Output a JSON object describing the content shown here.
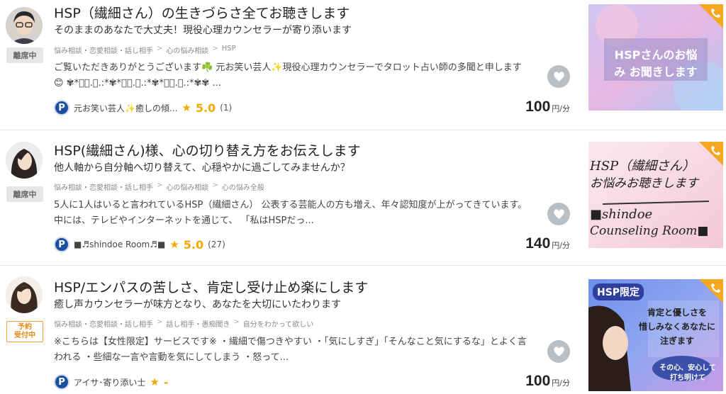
{
  "listings": [
    {
      "title": "HSP（繊細さん）の生きづらさ全てお聴きします",
      "subtitle": "そのままのあなたで大丈夫！現役心理カウンセラーが寄り添います",
      "status": "離席中",
      "breadcrumb": [
        "悩み相談・恋愛相談・話し相手",
        "心の悩み相談",
        "HSP"
      ],
      "description": "ご覧いただきありがとうございます☘️ 元お笑い芸人✨現役心理カウンセラーでタロット占い師の多聞と申します😊 ✾*ﾟ･.｡.:*✾*ﾟ･.｡.:*✾*ﾟ･.｡.:*✾✾ ...",
      "provider": "元お笑い芸人✨癒しの傾...",
      "rating": "5.0",
      "review_count": "(1)",
      "price": "100",
      "price_unit": "円/分",
      "thumb_text": [
        "HSPさんのお悩",
        "み お聞きします"
      ]
    },
    {
      "title": "HSP(繊細さん)様、心の切り替え方をお伝えします",
      "subtitle": "他人軸から自分軸へ切り替えて、心穏やかに過ごしてみませんか？",
      "status": "離席中",
      "breadcrumb": [
        "悩み相談・恋愛相談・話し相手",
        "心の悩み相談",
        "心の悩み全般"
      ],
      "description": "5人に1人はいると言われているHSP（繊細さん） 公表する芸能人の方も増え、年々認知度が上がってきています。 中には、テレビやインターネットを通じて、 「私はHSPだっ...",
      "provider": "■♬shindoe Room♬■",
      "rating": "5.0",
      "review_count": "(27)",
      "price": "140",
      "price_unit": "円/分",
      "thumb_text": [
        "HSP（繊細さん）",
        "お悩みお聴きします",
        "■shindoe",
        "Counseling Room■"
      ]
    },
    {
      "title": "HSP/エンパスの苦しさ、肯定し受け止め楽にします",
      "subtitle": "癒し声カウンセラーが味方となり、あなたを大切にいたわります",
      "status": "予約\n受付中",
      "breadcrumb": [
        "悩み相談・恋愛相談・話し相手",
        "話し相手・愚痴聞き",
        "自分をわかって欲しい"
      ],
      "description": "※こちらは【女性限定】サービスです※ ・繊細で傷つきやすい ・「気にしすぎ」「そんなこと気にするな」とよく言われる ・些細な一言や言動を気にしてしまう ・怒って...",
      "provider": "アイサ･寄り添い士",
      "rating": "-",
      "review_count": "",
      "price": "100",
      "price_unit": "円/分",
      "thumb_text": [
        "HSP限定",
        "肯定と優しさを",
        "惜しみなくあなたに",
        "注ぎます",
        "その心、安心して",
        "打ち明けて"
      ]
    }
  ],
  "colors": {
    "accent": "#f2a900",
    "phone_badge": "#f5a623",
    "provider_badge": "#1d4fa0",
    "fav": "#b9c0c5"
  }
}
